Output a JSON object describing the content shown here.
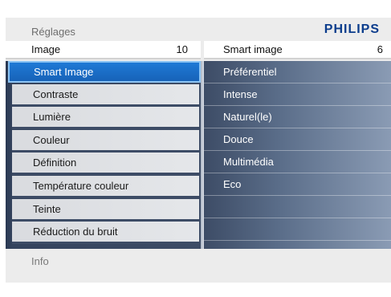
{
  "header": {
    "title": "Réglages",
    "brand": "PHILIPS",
    "left_label": "Image",
    "left_count": "10",
    "right_label": "Smart image",
    "right_count": "6"
  },
  "menu": {
    "items": [
      {
        "label": "Smart Image",
        "selected": true
      },
      {
        "label": "Contraste"
      },
      {
        "label": "Lumière"
      },
      {
        "label": "Couleur"
      },
      {
        "label": "Définition"
      },
      {
        "label": "Température couleur"
      },
      {
        "label": "Teinte"
      },
      {
        "label": "Réduction du bruit"
      }
    ]
  },
  "submenu": {
    "items": [
      {
        "label": "Préférentiel"
      },
      {
        "label": "Intense"
      },
      {
        "label": "Naturel(le)"
      },
      {
        "label": "Douce"
      },
      {
        "label": "Multimédia"
      },
      {
        "label": "Eco"
      }
    ]
  },
  "footer": {
    "info": "Info"
  },
  "colors": {
    "brand": "#0b3c8c",
    "selection": "#1f7ad6",
    "panel": "#3d4c66"
  }
}
